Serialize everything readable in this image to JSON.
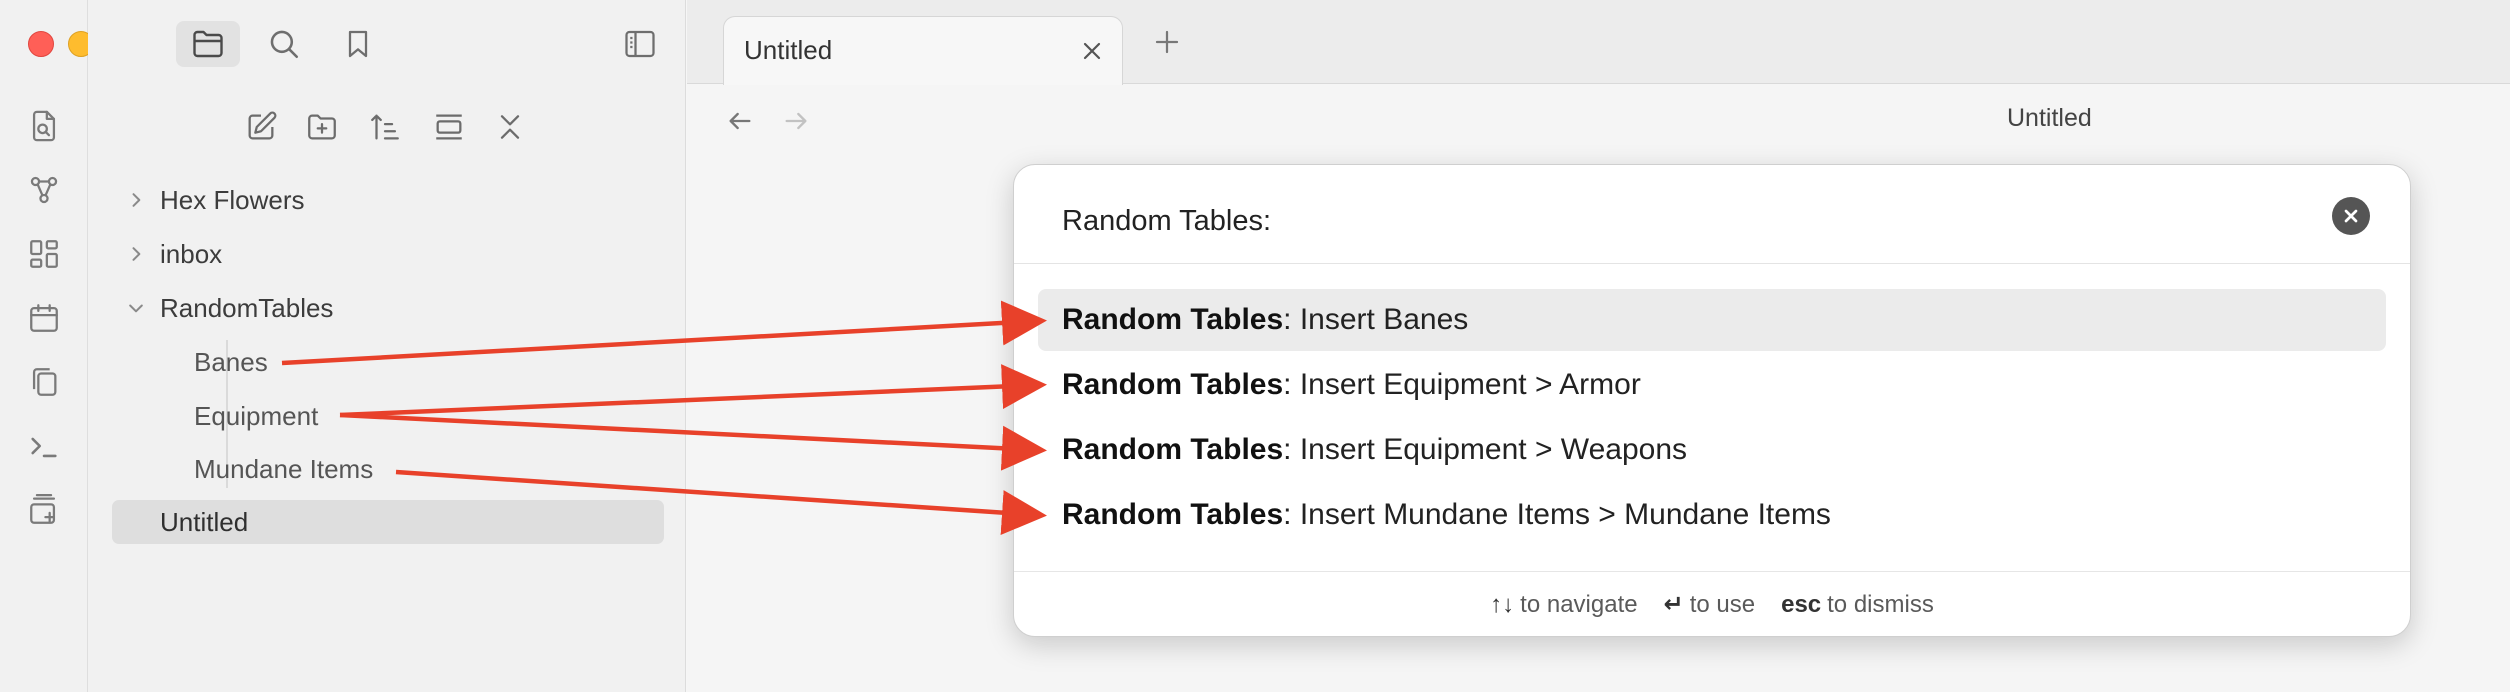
{
  "colors": {
    "accent_arrow": "#e8412a",
    "traffic_red": "#ff5f57",
    "traffic_yellow": "#febc2e",
    "traffic_green": "#28c840",
    "selected_row": "#ebebeb"
  },
  "window_controls": [
    "close",
    "minimize",
    "zoom"
  ],
  "sidebar": {
    "top_tabs": [
      {
        "icon": "folder-icon",
        "active": true
      },
      {
        "icon": "search-icon",
        "active": false
      },
      {
        "icon": "bookmark-icon",
        "active": false
      }
    ],
    "toggle_icon": "sidebar-toggle-icon",
    "nav_actions": [
      "new-note-icon",
      "new-folder-icon",
      "sort-icon",
      "auto-reveal-icon",
      "collapse-all-icon"
    ],
    "tree": [
      {
        "label": "Hex Flowers",
        "type": "folder",
        "expanded": false
      },
      {
        "label": "inbox",
        "type": "folder",
        "expanded": false
      },
      {
        "label": "RandomTables",
        "type": "folder",
        "expanded": true
      },
      {
        "label": "Banes",
        "type": "file",
        "child": true
      },
      {
        "label": "Equipment",
        "type": "file",
        "child": true
      },
      {
        "label": "Mundane Items",
        "type": "file",
        "child": true
      },
      {
        "label": "Untitled",
        "type": "file",
        "selected": true
      }
    ]
  },
  "ribbon": {
    "icons": [
      "open-quick-switcher-icon",
      "graph-view-icon",
      "canvas-icon",
      "daily-note-icon",
      "templates-icon",
      "terminal-icon",
      "command-palette-icon"
    ]
  },
  "tabs": {
    "items": [
      {
        "label": "Untitled",
        "active": true
      }
    ],
    "new_tab_icon": "plus-icon"
  },
  "view": {
    "title": "Untitled",
    "back_icon": "arrow-left-icon",
    "forward_icon": "arrow-right-icon"
  },
  "palette": {
    "input_value": "Random Tables:",
    "suggestions": [
      {
        "prefix": "Random Tables",
        "rest": ": Insert Banes",
        "selected": true
      },
      {
        "prefix": "Random Tables",
        "rest": ": Insert Equipment > Armor",
        "selected": false
      },
      {
        "prefix": "Random Tables",
        "rest": ": Insert Equipment > Weapons",
        "selected": false
      },
      {
        "prefix": "Random Tables",
        "rest": ": Insert Mundane Items > Mundane Items",
        "selected": false
      }
    ],
    "instructions": [
      {
        "command": "↑↓",
        "purpose": "to navigate"
      },
      {
        "command": "↵",
        "purpose": "to use"
      },
      {
        "command": "esc",
        "purpose": "to dismiss"
      }
    ]
  }
}
